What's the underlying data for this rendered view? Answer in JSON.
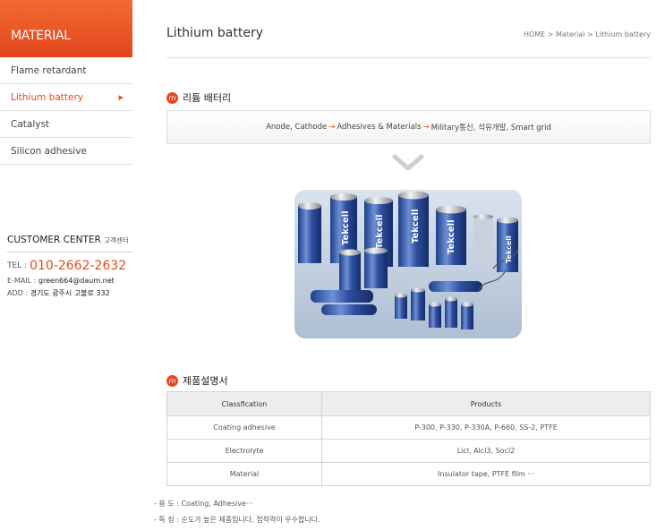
{
  "sidebar": {
    "title": "MATERIAL",
    "items": [
      {
        "label": "Flame retardant"
      },
      {
        "label": "Lithium battery"
      },
      {
        "label": "Catalyst"
      },
      {
        "label": "Silicon adhesive"
      }
    ]
  },
  "customer_center": {
    "title": "CUSTOMER CENTER",
    "title_kr": "고객센터",
    "tel_label": "TEL :",
    "tel": "010-2662-2632",
    "email_label": "E-MAIL :",
    "email": "green664@daum.net",
    "addr_label": "ADD :",
    "addr": "경기도 광주시 고불로 332"
  },
  "header": {
    "title": "Lithium battery",
    "breadcrumb": "HOME > Material > Lithium battery"
  },
  "section1": {
    "title": "리튬 배터리",
    "flow": {
      "part1": "Anode, Cathode",
      "part2": "Adhesives & Materials",
      "part3": "Military통신, 석유개발, Smart grid",
      "arrow": "→"
    }
  },
  "product_image": {
    "brand": "Tekcell"
  },
  "section2": {
    "title": "제품설명서",
    "table": {
      "headers": [
        "Classfication",
        "Products"
      ],
      "rows": [
        [
          "Coating adhesive",
          "P-300, P-330, P-330A, P-660, SS-2, PTFE"
        ],
        [
          "Electrolyte",
          "Licl, Alcl3, Socl2"
        ],
        [
          "Material",
          "Insulator tape, PTFE film ···"
        ]
      ]
    },
    "notes": [
      "- 용 도 : Coating, Adhesive···",
      "- 특 징 : 순도가 높은 제품입니다. 접착력이 우수합니다."
    ]
  },
  "colors": {
    "accent": "#e8471b",
    "header_bg": "#f26a32"
  },
  "icons": {
    "section_mark": "m-circle-icon",
    "down": "chevron-down-icon",
    "menu_arrow": "triangle-right-icon"
  }
}
